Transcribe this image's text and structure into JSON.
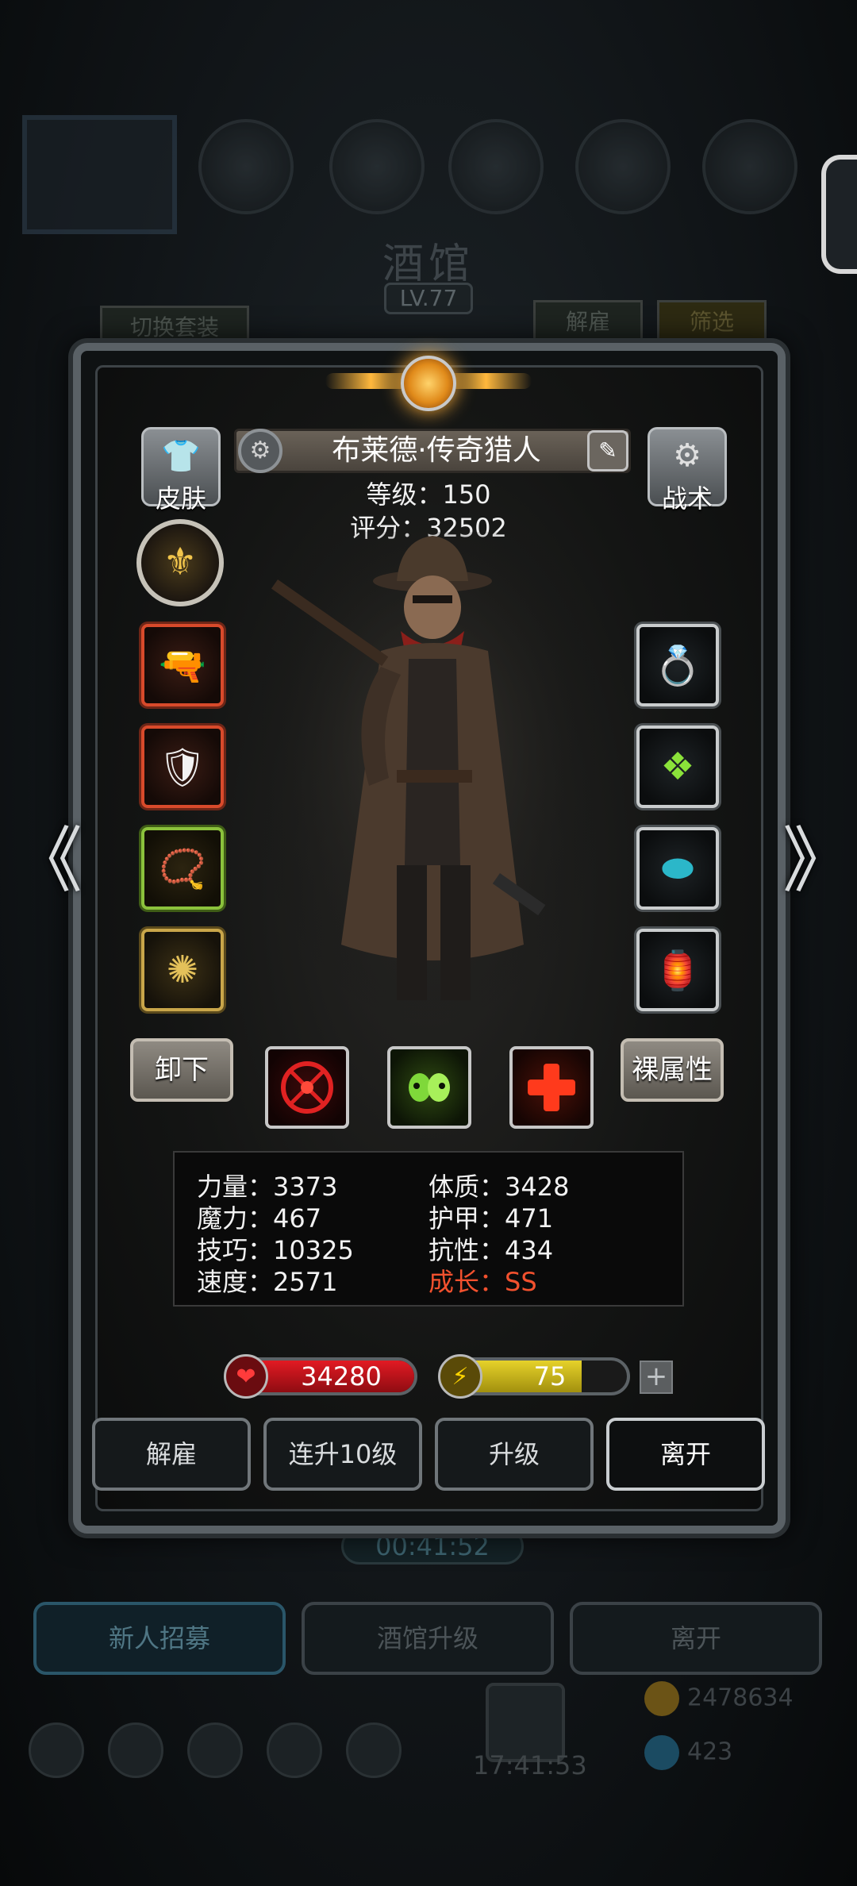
{
  "background": {
    "title": "酒馆",
    "level": "LV.77",
    "switch_outfit": "切换套装",
    "dismiss_tab": "解雇",
    "filter_tab": "筛选",
    "timer": "00:41:52",
    "buttons": [
      "新人招募",
      "酒馆升级",
      "离开"
    ],
    "clock": "17:41:53",
    "gold": "2478634",
    "gems": "423"
  },
  "hero": {
    "name": "布莱德·传奇猎人",
    "level_text": "等级：150",
    "score_text": "评分：32502"
  },
  "side": {
    "skin_label": "皮肤",
    "tactics_label": "战术",
    "unequip_label": "卸下",
    "bare_attr_label": "裸属性"
  },
  "equipment": {
    "left": [
      {
        "icon": "pistol-icon",
        "glyph": "🔫",
        "rarity": "red"
      },
      {
        "icon": "armor-icon",
        "glyph": "🛡",
        "rarity": "red"
      },
      {
        "icon": "amulet-icon",
        "glyph": "📿",
        "rarity": "green"
      },
      {
        "icon": "medallion-icon",
        "glyph": "✺",
        "rarity": "gold"
      }
    ],
    "right": [
      {
        "icon": "ring-icon",
        "glyph": "💍",
        "rarity": "silver"
      },
      {
        "icon": "green-crystal-icon",
        "glyph": "❖",
        "rarity": "silver"
      },
      {
        "icon": "cyan-gem-icon",
        "glyph": "⬬",
        "rarity": "silver"
      },
      {
        "icon": "lantern-icon",
        "glyph": "🏮",
        "rarity": "silver"
      }
    ]
  },
  "skills": [
    {
      "icon": "red-target-icon",
      "color": "#e02222"
    },
    {
      "icon": "green-skulls-icon",
      "color": "#7fd83a"
    },
    {
      "icon": "red-cross-icon",
      "color": "#ff3a1c"
    }
  ],
  "stats": {
    "strength": "力量：3373",
    "magic": "魔力：467",
    "skill": "技巧：10325",
    "speed": "速度：2571",
    "constitution": "体质：3428",
    "armor": "护甲：471",
    "resistance": "抗性：434",
    "growth": "成长：SS"
  },
  "bars": {
    "hp": "34280",
    "energy": "75",
    "energy_fraction": 0.75,
    "plus": "+"
  },
  "actions": {
    "dismiss": "解雇",
    "level_up_10": "连升10级",
    "level_up": "升级",
    "leave": "离开"
  },
  "arrows": {
    "left": "《",
    "right": "》"
  },
  "colors": {
    "growth": "#f2512e",
    "hp": "#c8121b",
    "energy": "#d8c21c"
  }
}
